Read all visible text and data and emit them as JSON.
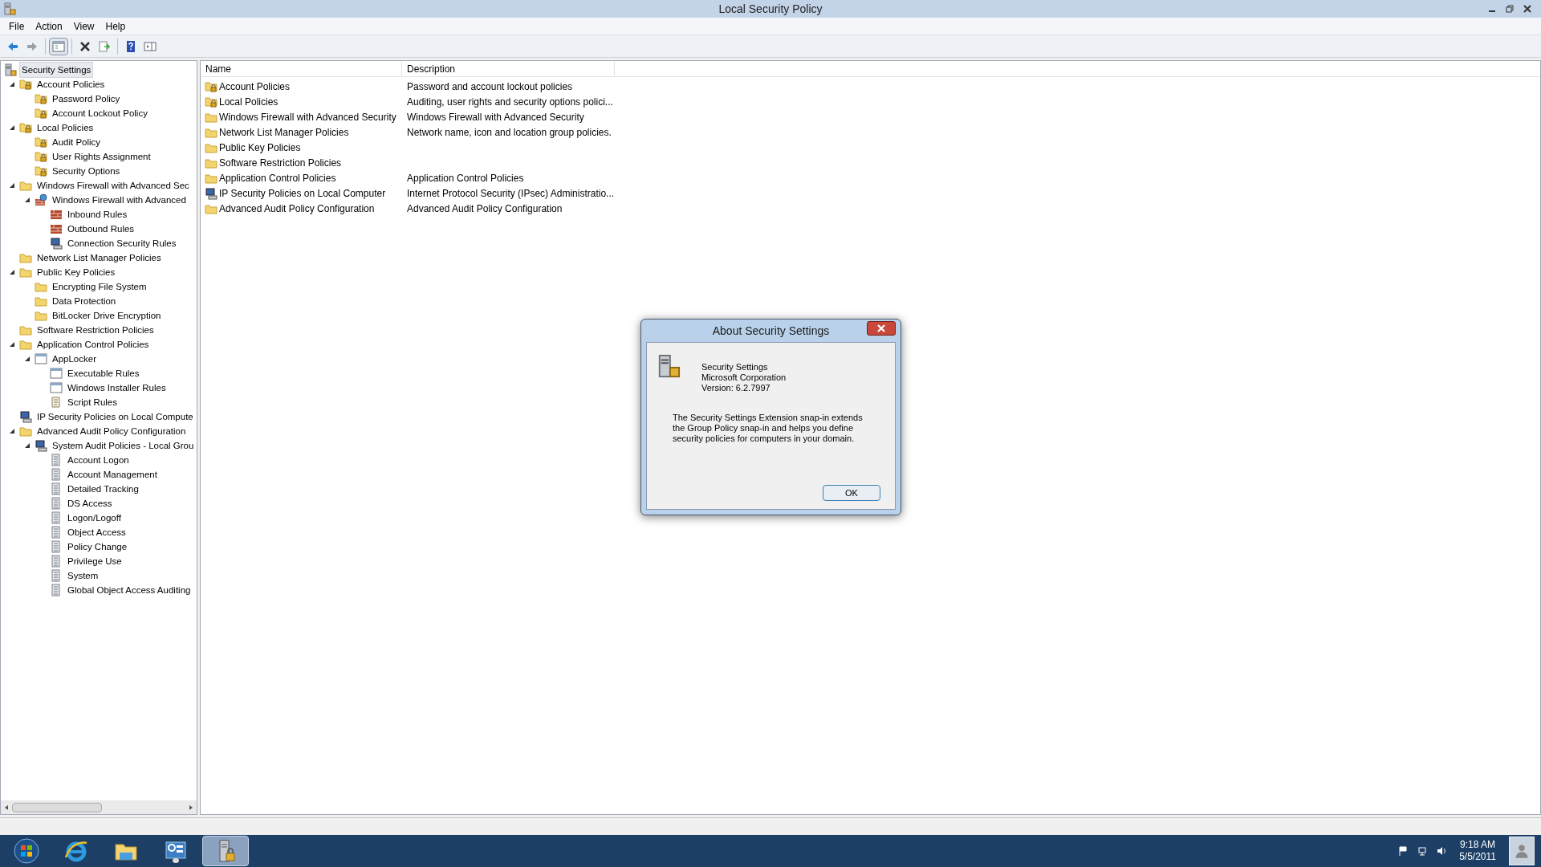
{
  "window": {
    "title": "Local Security Policy"
  },
  "menu": [
    "File",
    "Action",
    "View",
    "Help"
  ],
  "toolbar": [
    {
      "kind": "back",
      "disabled": false
    },
    {
      "kind": "forward",
      "disabled": true
    },
    {
      "kind": "sep"
    },
    {
      "kind": "tree",
      "selected": true
    },
    {
      "kind": "sep"
    },
    {
      "kind": "delete"
    },
    {
      "kind": "export"
    },
    {
      "kind": "sep"
    },
    {
      "kind": "help"
    },
    {
      "kind": "pane"
    }
  ],
  "tree": [
    {
      "label": "Security Settings",
      "kind": "server",
      "selected": true,
      "children": [
        {
          "label": "Account Policies",
          "kind": "lockfolder",
          "selected": false,
          "expanded": true,
          "children": [
            {
              "label": "Password Policy",
              "kind": "lockfolder",
              "selected": false
            },
            {
              "label": "Account Lockout Policy",
              "kind": "lockfolder",
              "selected": false
            }
          ]
        },
        {
          "label": "Local Policies",
          "kind": "lockfolder",
          "selected": false,
          "expanded": true,
          "children": [
            {
              "label": "Audit Policy",
              "kind": "lockfolder",
              "selected": false
            },
            {
              "label": "User Rights Assignment",
              "kind": "lockfolder",
              "selected": false
            },
            {
              "label": "Security Options",
              "kind": "lockfolder",
              "selected": false
            }
          ]
        },
        {
          "label": "Windows Firewall with Advanced Sec",
          "kind": "folder",
          "selected": false,
          "expanded": true,
          "children": [
            {
              "label": "Windows Firewall with Advanced",
              "kind": "firewall",
              "selected": false,
              "expanded": true,
              "children": [
                {
                  "label": "Inbound Rules",
                  "kind": "rules",
                  "selected": false
                },
                {
                  "label": "Outbound Rules",
                  "kind": "rules",
                  "selected": false
                },
                {
                  "label": "Connection Security Rules",
                  "kind": "computer",
                  "selected": false
                }
              ]
            }
          ]
        },
        {
          "label": "Network List Manager Policies",
          "kind": "folder",
          "selected": false
        },
        {
          "label": "Public Key Policies",
          "kind": "folder",
          "selected": false,
          "expanded": true,
          "children": [
            {
              "label": "Encrypting File System",
              "kind": "folder",
              "selected": false
            },
            {
              "label": "Data Protection",
              "kind": "folder",
              "selected": false
            },
            {
              "label": "BitLocker Drive Encryption",
              "kind": "folder",
              "selected": false
            }
          ]
        },
        {
          "label": "Software Restriction Policies",
          "kind": "folder",
          "selected": false
        },
        {
          "label": "Application Control Policies",
          "kind": "folder",
          "selected": false,
          "expanded": true,
          "children": [
            {
              "label": "AppLocker",
              "kind": "window",
              "selected": false,
              "expanded": true,
              "children": [
                {
                  "label": "Executable Rules",
                  "kind": "window",
                  "selected": false
                },
                {
                  "label": "Windows Installer Rules",
                  "kind": "window",
                  "selected": false
                },
                {
                  "label": "Script Rules",
                  "kind": "script",
                  "selected": false
                }
              ]
            }
          ]
        },
        {
          "label": "IP Security Policies on Local Compute",
          "kind": "computer",
          "selected": false
        },
        {
          "label": "Advanced Audit Policy Configuration",
          "kind": "folder",
          "selected": false,
          "expanded": true,
          "children": [
            {
              "label": "System Audit Policies - Local Grou",
              "kind": "computer",
              "selected": false,
              "expanded": true,
              "children": [
                {
                  "label": "Account Logon",
                  "kind": "policy",
                  "selected": false
                },
                {
                  "label": "Account Management",
                  "kind": "policy",
                  "selected": false
                },
                {
                  "label": "Detailed Tracking",
                  "kind": "policy",
                  "selected": false
                },
                {
                  "label": "DS Access",
                  "kind": "policy",
                  "selected": false
                },
                {
                  "label": "Logon/Logoff",
                  "kind": "policy",
                  "selected": false
                },
                {
                  "label": "Object Access",
                  "kind": "policy",
                  "selected": false
                },
                {
                  "label": "Policy Change",
                  "kind": "policy",
                  "selected": false
                },
                {
                  "label": "Privilege Use",
                  "kind": "policy",
                  "selected": false
                },
                {
                  "label": "System",
                  "kind": "policy",
                  "selected": false
                },
                {
                  "label": "Global Object Access Auditing",
                  "kind": "policy",
                  "selected": false
                }
              ]
            }
          ]
        }
      ]
    }
  ],
  "list": {
    "columns": [
      "Name",
      "Description"
    ],
    "rows": [
      {
        "name": "Account Policies",
        "description": "Password and account lockout policies",
        "kind": "lockfolder"
      },
      {
        "name": "Local Policies",
        "description": "Auditing, user rights and security options polici...",
        "kind": "lockfolder"
      },
      {
        "name": "Windows Firewall with Advanced Security",
        "description": "Windows Firewall with Advanced Security",
        "kind": "folder"
      },
      {
        "name": "Network List Manager Policies",
        "description": "Network name, icon and location group policies.",
        "kind": "folder"
      },
      {
        "name": "Public Key Policies",
        "kind": "folder"
      },
      {
        "name": "Software Restriction Policies",
        "kind": "folder"
      },
      {
        "name": "Application Control Policies",
        "description": "Application Control Policies",
        "kind": "folder"
      },
      {
        "name": "IP Security Policies on Local Computer",
        "description": "Internet Protocol Security (IPsec) Administratio...",
        "kind": "computer"
      },
      {
        "name": "Advanced Audit Policy Configuration",
        "description": "Advanced Audit Policy Configuration",
        "kind": "folder"
      }
    ]
  },
  "dialog": {
    "title": "About Security Settings",
    "product": "Security Settings",
    "company": "Microsoft Corporation",
    "version": "Version: 6.2.7997",
    "text": "The Security Settings Extension snap-in extends the Group Policy snap-in and helps you define security policies for computers in your domain.",
    "button": "OK"
  },
  "taskbar": {
    "apps": [
      {
        "kind": "start",
        "selected": false
      },
      {
        "kind": "browser",
        "selected": false
      },
      {
        "kind": "explorer",
        "selected": false
      },
      {
        "kind": "control",
        "selected": false
      },
      {
        "kind": "security",
        "selected": true
      }
    ],
    "time": "9:18 AM",
    "date": "5/5/2011"
  }
}
